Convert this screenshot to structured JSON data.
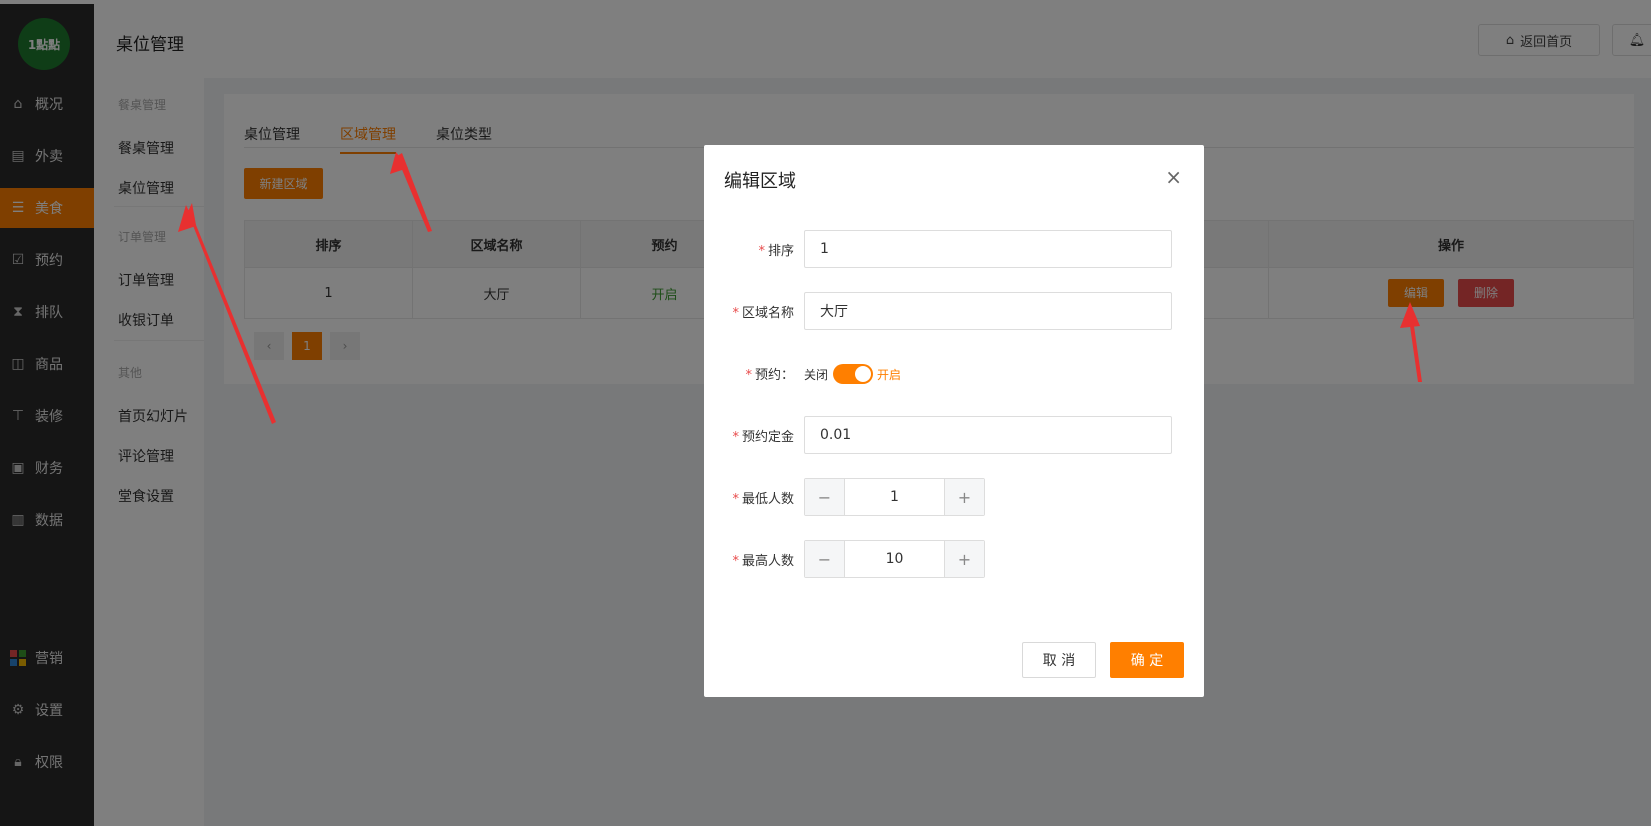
{
  "nav": {
    "logo_text": "1點點",
    "items": [
      {
        "label": "概况",
        "icon": "home-icon"
      },
      {
        "label": "外卖",
        "icon": "document-icon"
      },
      {
        "label": "美食",
        "icon": "menu-icon"
      },
      {
        "label": "预约",
        "icon": "calendar-check-icon"
      },
      {
        "label": "排队",
        "icon": "hourglass-icon"
      },
      {
        "label": "商品",
        "icon": "bag-icon"
      },
      {
        "label": "装修",
        "icon": "brush-icon"
      },
      {
        "label": "财务",
        "icon": "wallet-icon"
      },
      {
        "label": "数据",
        "icon": "bar-chart-icon"
      },
      {
        "label": "营销",
        "icon": "grid-colored-icon"
      },
      {
        "label": "设置",
        "icon": "gear-icon"
      },
      {
        "label": "权限",
        "icon": "lock-icon"
      }
    ],
    "active_index": 2,
    "accent": "#ff7f00"
  },
  "header": {
    "title": "桌位管理",
    "home_button": "返回首页"
  },
  "submenu": {
    "groups": [
      {
        "title": "餐桌管理",
        "items": [
          "餐桌管理",
          "桌位管理"
        ]
      },
      {
        "title": "订单管理",
        "items": [
          "订单管理",
          "收银订单"
        ]
      },
      {
        "title": "其他",
        "items": [
          "首页幻灯片",
          "评论管理",
          "堂食设置"
        ]
      }
    ]
  },
  "content": {
    "tabs": [
      "桌位管理",
      "区域管理",
      "桌位类型"
    ],
    "active_tab": 1,
    "new_button": "新建区域",
    "table": {
      "headers": [
        "排序",
        "区域名称",
        "预约",
        "操作"
      ],
      "rows": [
        {
          "order": "1",
          "name": "大厅",
          "reserve": "开启",
          "edit": "编辑",
          "delete": "删除"
        }
      ]
    },
    "pager": {
      "prev": "‹",
      "current": "1",
      "next": "›"
    }
  },
  "modal": {
    "title": "编辑区域",
    "fields": {
      "order_label": "排序",
      "order_value": "1",
      "name_label": "区域名称",
      "name_value": "大厅",
      "reserve_label": "预约：",
      "reserve_off": "关闭",
      "reserve_on": "开启",
      "deposit_label": "预约定金",
      "deposit_value": "0.01",
      "min_label": "最低人数",
      "min_value": "1",
      "max_label": "最高人数",
      "max_value": "10"
    },
    "cancel": "取 消",
    "confirm": "确 定"
  }
}
